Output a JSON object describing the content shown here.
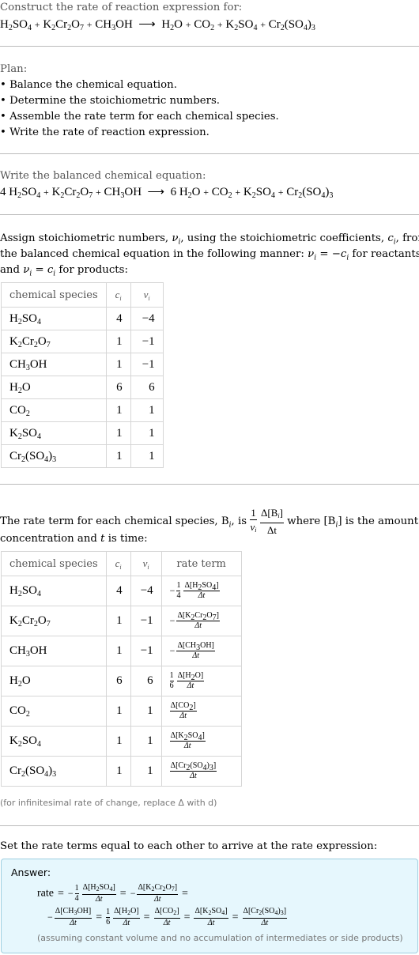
{
  "intro": {
    "heading": "Construct the rate of reaction expression for:",
    "reaction": {
      "reactants": [
        {
          "base": "H",
          "parts": [
            [
              "H",
              "2"
            ],
            [
              "SO",
              "4"
            ]
          ]
        },
        {
          "parts": [
            [
              "K",
              "2"
            ],
            [
              "Cr",
              "2"
            ],
            [
              "O",
              "7"
            ]
          ]
        },
        {
          "parts": [
            [
              "CH",
              "3"
            ],
            [
              "OH",
              ""
            ]
          ]
        }
      ],
      "products": [
        {
          "parts": [
            [
              "H",
              "2"
            ],
            [
              "O",
              ""
            ]
          ]
        },
        {
          "parts": [
            [
              "CO",
              "2"
            ]
          ]
        },
        {
          "parts": [
            [
              "K",
              "2"
            ],
            [
              "SO",
              "4"
            ]
          ]
        },
        {
          "parts": [
            [
              "Cr",
              "2"
            ],
            [
              "(SO",
              "4"
            ],
            [
              ")",
              "3"
            ]
          ]
        }
      ],
      "arrow": "⟶",
      "plus": "+"
    }
  },
  "plan": {
    "heading": "Plan:",
    "items": [
      "• Balance the chemical equation.",
      "• Determine the stoichiometric numbers.",
      "• Assemble the rate term for each chemical species.",
      "• Write the rate of reaction expression."
    ]
  },
  "balanced": {
    "heading": "Write the balanced chemical equation:",
    "coefficients": [
      "4",
      "",
      "",
      "6",
      "",
      "",
      ""
    ]
  },
  "assign": {
    "line1": "Assign stoichiometric numbers, ",
    "nu_i": "ν",
    "sub_i": "i",
    "line1b": ", using the stoichiometric coefficients, ",
    "c_i": "c",
    "line1c": ", from",
    "line2": "the balanced chemical equation in the following manner: ",
    "line2b": " = −",
    "line2c": " for reactants",
    "line3": "and ",
    "line3b": " = ",
    "line3c": " for products:"
  },
  "table1": {
    "headers": [
      "chemical species",
      "c",
      "ν"
    ],
    "rows": [
      {
        "species": [
          [
            "H",
            "2"
          ],
          [
            "SO",
            "4"
          ]
        ],
        "c": "4",
        "nu": "−4"
      },
      {
        "species": [
          [
            "K",
            "2"
          ],
          [
            "Cr",
            "2"
          ],
          [
            "O",
            "7"
          ]
        ],
        "c": "1",
        "nu": "−1"
      },
      {
        "species": [
          [
            "CH",
            "3"
          ],
          [
            "OH",
            ""
          ]
        ],
        "c": "1",
        "nu": "−1"
      },
      {
        "species": [
          [
            "H",
            "2"
          ],
          [
            "O",
            ""
          ]
        ],
        "c": "6",
        "nu": "6"
      },
      {
        "species": [
          [
            "CO",
            "2"
          ]
        ],
        "c": "1",
        "nu": "1"
      },
      {
        "species": [
          [
            "K",
            "2"
          ],
          [
            "SO",
            "4"
          ]
        ],
        "c": "1",
        "nu": "1"
      },
      {
        "species": [
          [
            "Cr",
            "2"
          ],
          [
            "(SO",
            "4"
          ],
          [
            ")",
            "3"
          ]
        ],
        "c": "1",
        "nu": "1"
      }
    ]
  },
  "rateterm": {
    "line1a": "The rate term for each chemical species, B",
    "line1b": ", is ",
    "frac_num": "1",
    "frac_num2": "Δ[B",
    "frac_den2": "Δt",
    "line1c": " where [B",
    "line1d": "] is the amount",
    "line2a": "concentration and ",
    "t": "t",
    "line2b": " is time:"
  },
  "table2": {
    "headers": [
      "chemical species",
      "c",
      "ν",
      "rate term"
    ],
    "rows": [
      {
        "species": [
          [
            "H",
            "2"
          ],
          [
            "SO",
            "4"
          ]
        ],
        "c": "4",
        "nu": "−4",
        "sign": "−",
        "coef": [
          "1",
          "4"
        ],
        "conc": [
          [
            "Δ[H",
            "2"
          ],
          [
            "SO",
            "4"
          ],
          [
            "]",
            ""
          ]
        ]
      },
      {
        "species": [
          [
            "K",
            "2"
          ],
          [
            "Cr",
            "2"
          ],
          [
            "O",
            "7"
          ]
        ],
        "c": "1",
        "nu": "−1",
        "sign": "−",
        "coef": null,
        "conc": [
          [
            "Δ[K",
            "2"
          ],
          [
            "Cr",
            "2"
          ],
          [
            "O",
            "7"
          ],
          [
            "]",
            ""
          ]
        ]
      },
      {
        "species": [
          [
            "CH",
            "3"
          ],
          [
            "OH",
            ""
          ]
        ],
        "c": "1",
        "nu": "−1",
        "sign": "−",
        "coef": null,
        "conc": [
          [
            "Δ[CH",
            "3"
          ],
          [
            "OH]",
            ""
          ]
        ]
      },
      {
        "species": [
          [
            "H",
            "2"
          ],
          [
            "O",
            ""
          ]
        ],
        "c": "6",
        "nu": "6",
        "sign": "",
        "coef": [
          "1",
          "6"
        ],
        "conc": [
          [
            "Δ[H",
            "2"
          ],
          [
            "O]",
            ""
          ]
        ]
      },
      {
        "species": [
          [
            "CO",
            "2"
          ]
        ],
        "c": "1",
        "nu": "1",
        "sign": "",
        "coef": null,
        "conc": [
          [
            "Δ[CO",
            "2"
          ],
          [
            "]",
            ""
          ]
        ]
      },
      {
        "species": [
          [
            "K",
            "2"
          ],
          [
            "SO",
            "4"
          ]
        ],
        "c": "1",
        "nu": "1",
        "sign": "",
        "coef": null,
        "conc": [
          [
            "Δ[K",
            "2"
          ],
          [
            "SO",
            "4"
          ],
          [
            "]",
            ""
          ]
        ]
      },
      {
        "species": [
          [
            "Cr",
            "2"
          ],
          [
            "(SO",
            "4"
          ],
          [
            ")",
            "3"
          ]
        ],
        "c": "1",
        "nu": "1",
        "sign": "",
        "coef": null,
        "conc": [
          [
            "Δ[Cr",
            "2"
          ],
          [
            "(SO",
            "4"
          ],
          [
            ")",
            "3"
          ],
          [
            "]",
            ""
          ]
        ]
      }
    ],
    "den": "Δt",
    "note": "(for infinitesimal rate of change, replace Δ with d)"
  },
  "final": {
    "heading": "Set the rate terms equal to each other to arrive at the rate expression:",
    "answer_label": "Answer:",
    "rate_word": "rate",
    "equals": "=",
    "footnote": "(assuming constant volume and no accumulation of intermediates or side products)"
  }
}
